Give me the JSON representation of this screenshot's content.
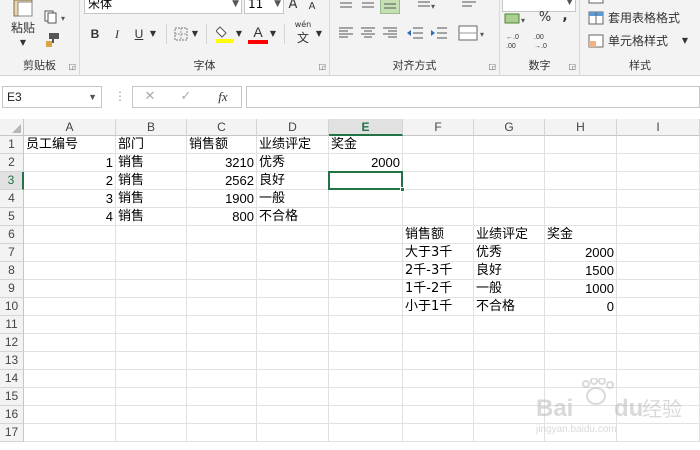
{
  "ribbon": {
    "clipboard": {
      "paste_label": "粘贴",
      "group_label": "剪贴板"
    },
    "font": {
      "font_name": "宋体",
      "font_size": "11",
      "grow_label": "A",
      "shrink_label": "A",
      "bold": "B",
      "italic": "I",
      "underline": "U",
      "font_color_label": "A",
      "phonetic_label": "wén",
      "phonetic_char": "文",
      "group_label": "字体"
    },
    "alignment": {
      "group_label": "对齐方式"
    },
    "number": {
      "percent": "%",
      "comma": ",",
      "inc_decimal": ".00\n→.0",
      "dec_decimal": ".00\n→.0",
      "group_label": "数字"
    },
    "styles": {
      "table_format_label": "套用表格格式",
      "cell_style_label": "单元格样式",
      "group_label": "样式"
    },
    "colors": {
      "highlight": "#ffff00",
      "font_color": "#ff0000",
      "accent": "#217346"
    }
  },
  "formula_bar": {
    "name_box": "E3",
    "fx_label": "fx",
    "cancel": "✕",
    "enter": "✓",
    "formula": ""
  },
  "grid": {
    "columns": [
      "A",
      "B",
      "C",
      "D",
      "E",
      "F",
      "G",
      "H",
      "I"
    ],
    "rows": [
      "1",
      "2",
      "3",
      "4",
      "5",
      "6",
      "7",
      "8",
      "9",
      "10",
      "11",
      "12",
      "13",
      "14",
      "15",
      "16",
      "17"
    ],
    "selected_cell": "E3",
    "cells": {
      "A1": "员工编号",
      "B1": "部门",
      "C1": "销售额",
      "D1": "业绩评定",
      "E1": "奖金",
      "A2": "1",
      "B2": "销售",
      "C2": "3210",
      "D2": "优秀",
      "E2": "2000",
      "A3": "2",
      "B3": "销售",
      "C3": "2562",
      "D3": "良好",
      "A4": "3",
      "B4": "销售",
      "C4": "1900",
      "D4": "一般",
      "A5": "4",
      "B5": "销售",
      "C5": "800",
      "D5": "不合格",
      "F6": "销售额",
      "G6": "业绩评定",
      "H6": "奖金",
      "F7": "大于3千",
      "G7": "优秀",
      "H7": "2000",
      "F8": "2千-3千",
      "G8": "良好",
      "H8": "1500",
      "F9": "1千-2千",
      "G9": "一般",
      "H9": "1000",
      "F10": "小于1千",
      "G10": "不合格",
      "H10": "0"
    }
  },
  "watermark": {
    "brand": "Bai",
    "brand2": "du",
    "suffix": "经验",
    "url": "jingyan.baidu.com"
  }
}
